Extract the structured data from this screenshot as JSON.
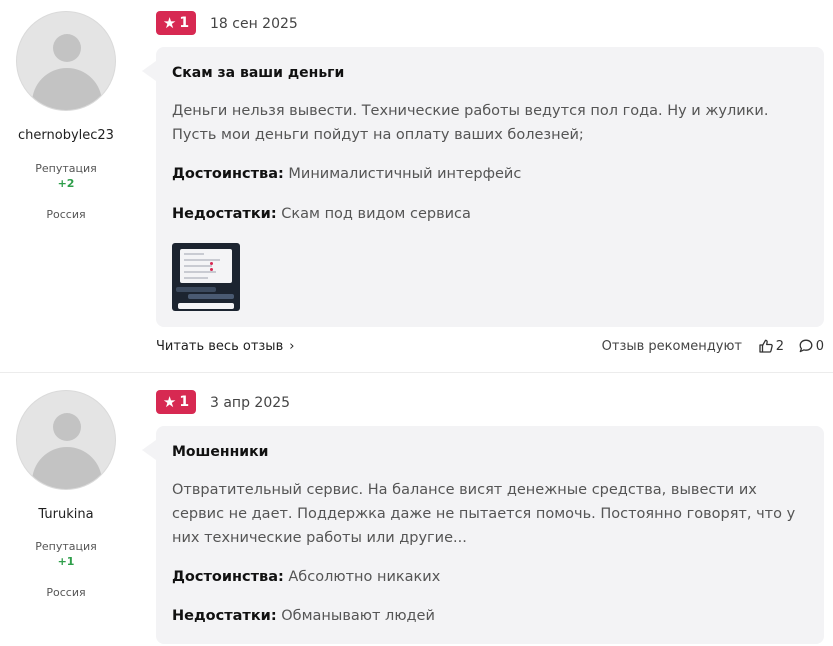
{
  "reviews": [
    {
      "author": {
        "name": "chernobylec23",
        "reputation_label": "Репутация",
        "reputation_value": "+2",
        "country": "Россия"
      },
      "rating": "1",
      "date": "18 сен 2025",
      "title": "Скам за ваши деньги",
      "text": "Деньги нельзя вывести. Технические работы ведутся пол года. Ну и жулики. Пусть мои деньги пойдут на оплату ваших болезней;",
      "pros_label": "Достоинства:",
      "pros": "Минималистичный интерфейс",
      "cons_label": "Недостатки:",
      "cons": "Скам под видом сервиса",
      "has_photo": true,
      "read_more": "Читать весь отзыв",
      "recommend_label": "Отзыв рекомендуют",
      "likes": "2",
      "comments": "0"
    },
    {
      "author": {
        "name": "Turukina",
        "reputation_label": "Репутация",
        "reputation_value": "+1",
        "country": "Россия"
      },
      "rating": "1",
      "date": "3 апр 2025",
      "title": "Мошенники",
      "text": "Отвратительный сервис. На балансе висят денежные средства, вывести их сервис не дает. Поддержка даже не пытается помочь. Постоянно говорят, что у них технические работы или другие...",
      "pros_label": "Достоинства:",
      "pros": "Абсолютно никаких",
      "cons_label": "Недостатки:",
      "cons": "Обманывают людей"
    }
  ],
  "colors": {
    "badge": "#d72952",
    "reputation_positive": "#2e9e4a",
    "card_bg": "#f3f3f5"
  },
  "icons": {
    "rating": "star-icon",
    "read_more": "chevron-right-icon",
    "likes": "thumbs-up-icon",
    "comments": "comment-bubble-icon"
  }
}
